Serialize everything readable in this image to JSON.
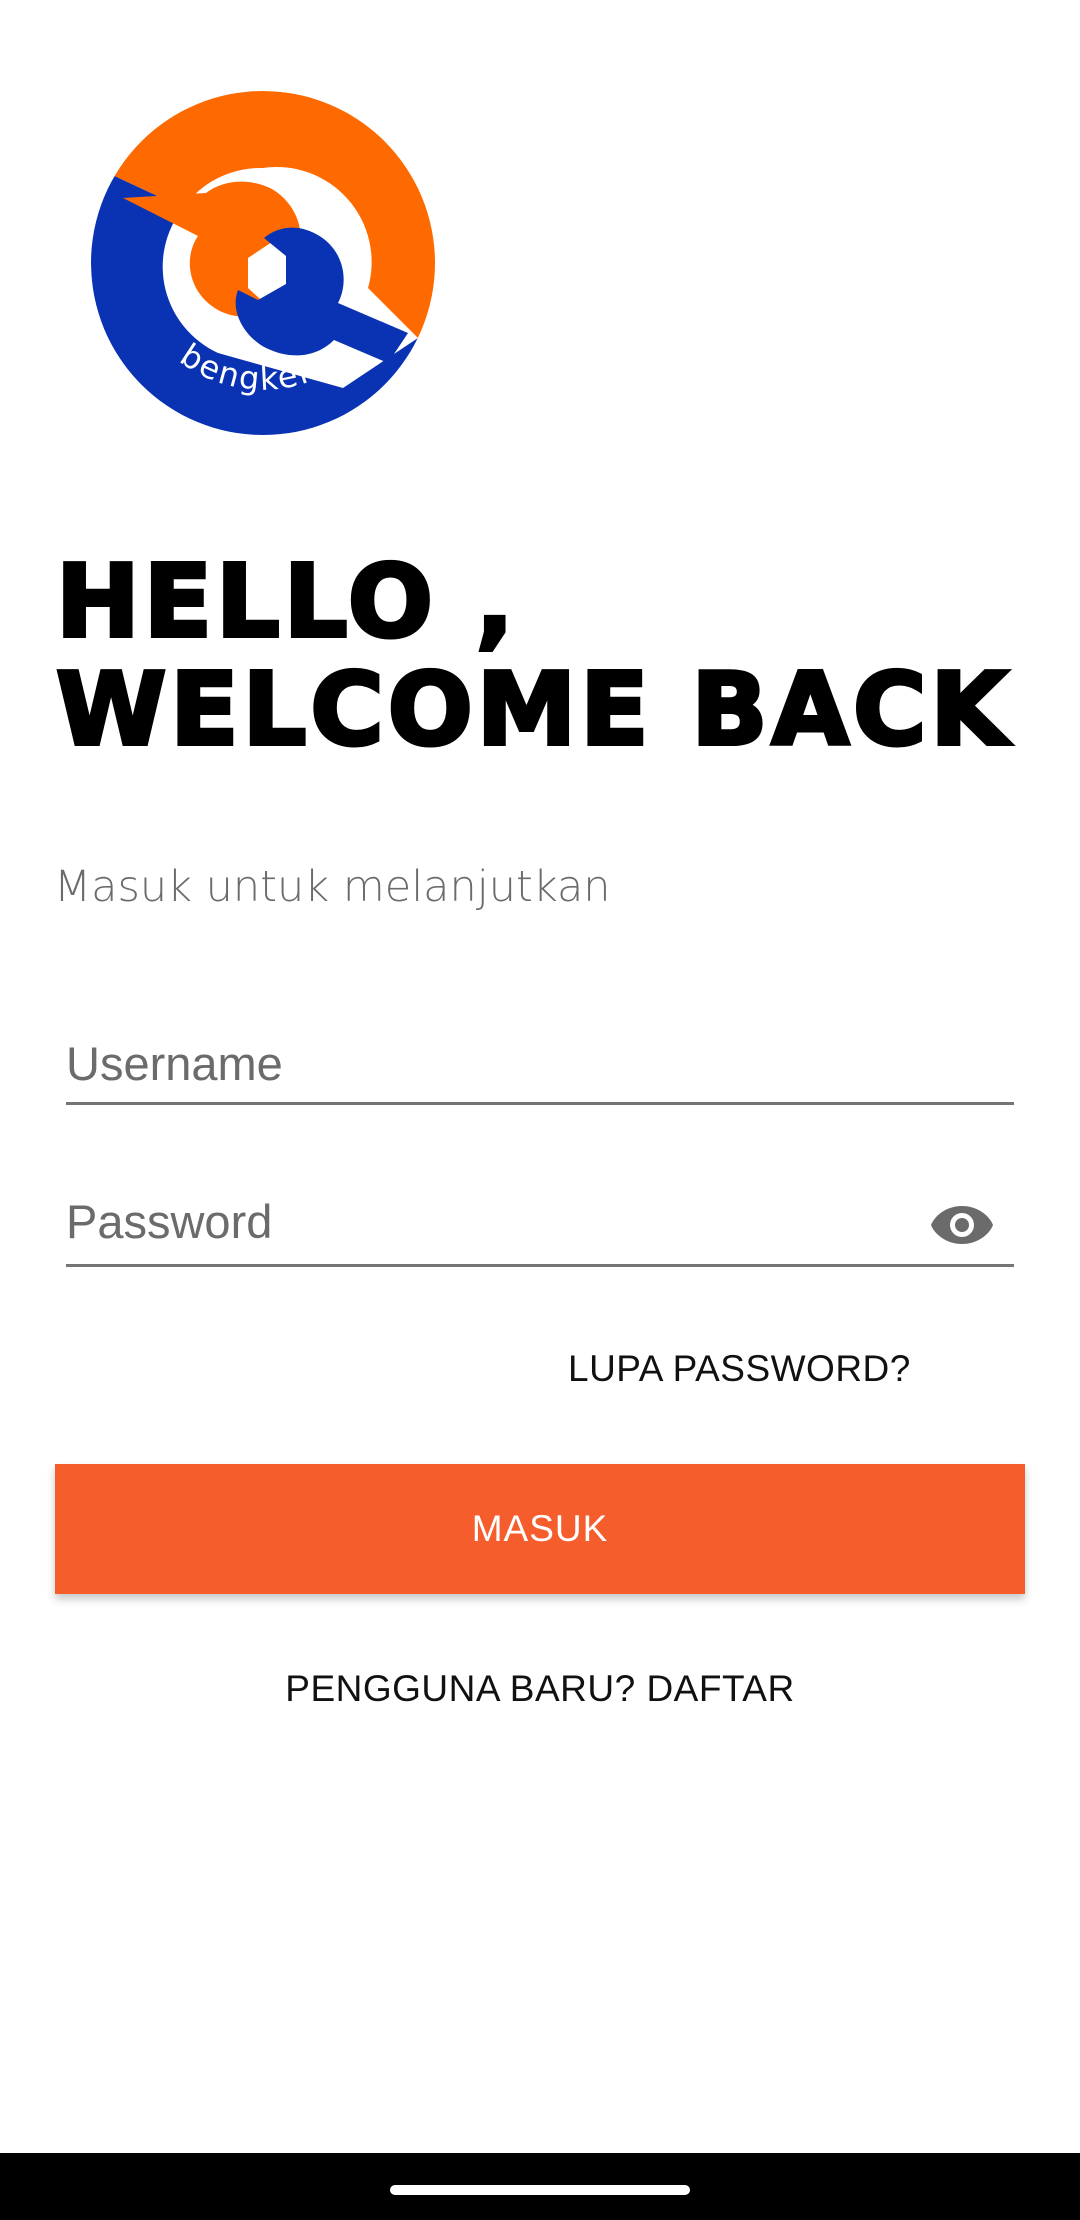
{
  "app": {
    "logo_text": "bengkelku",
    "logo_icon": "wrench-logo-icon"
  },
  "heading": {
    "line1": "HELLO ,",
    "line2": "WELCOME BACK"
  },
  "subtitle": "Masuk untuk melanjutkan",
  "form": {
    "username_placeholder": "Username",
    "username_value": "",
    "password_placeholder": "Password",
    "password_value": "",
    "password_toggle_icon": "eye-icon",
    "forgot_label": "LUPA PASSWORD?",
    "submit_label": "MASUK",
    "register_label": "PENGGUNA BARU? DAFTAR"
  },
  "colors": {
    "accent": "#f55d2c",
    "logo_orange": "#ff6a00",
    "logo_blue": "#0a33b3",
    "text_primary": "#000000",
    "text_secondary": "#6b6b6b"
  }
}
